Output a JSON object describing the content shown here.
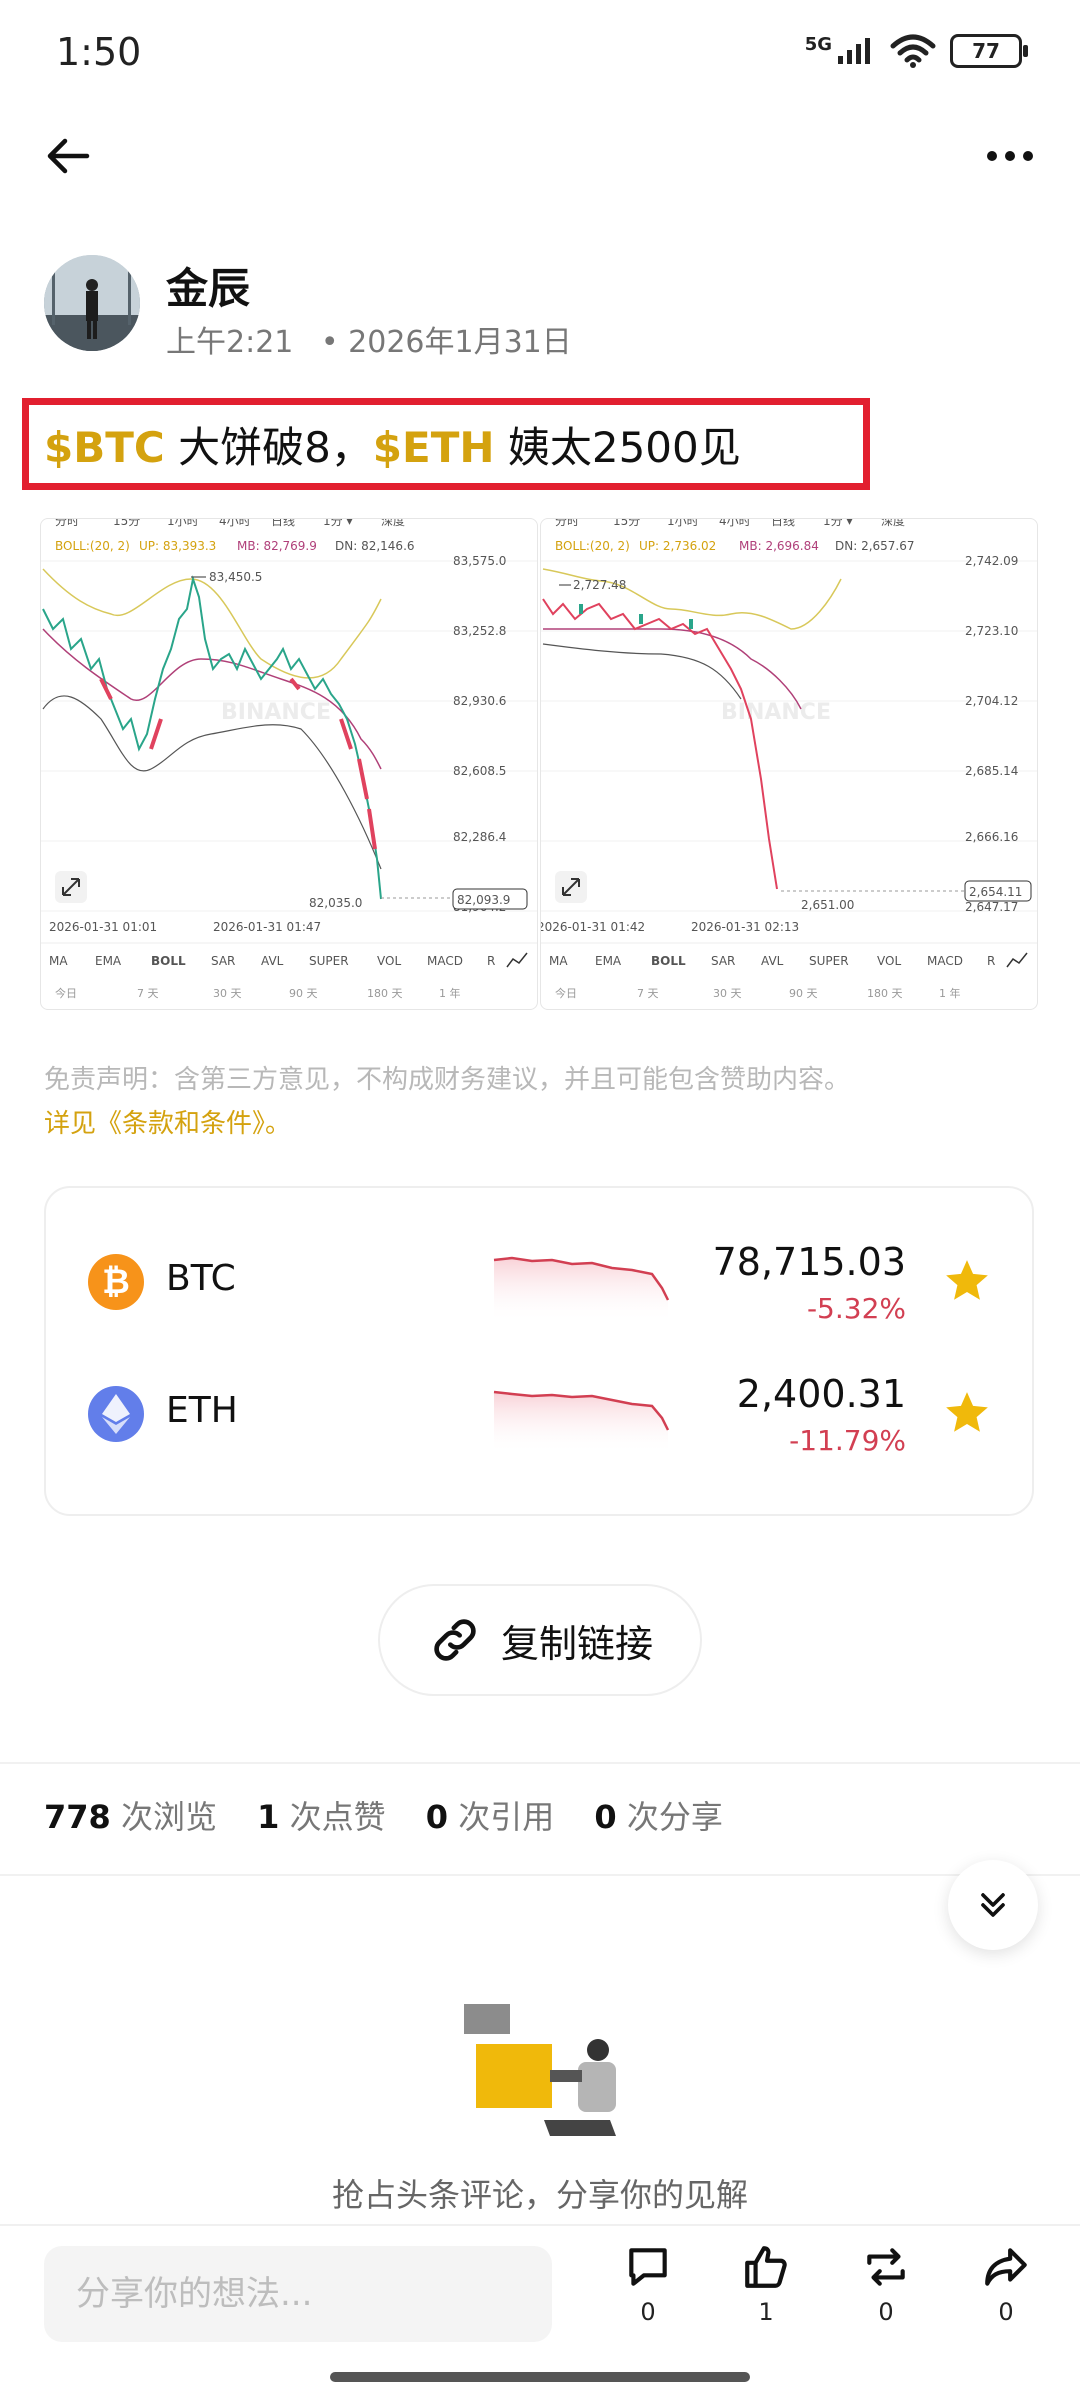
{
  "status": {
    "time": "1:50",
    "network": "5G",
    "battery": "77"
  },
  "post": {
    "author": "金辰",
    "time": "上午2:21",
    "date": "• 2026年1月31日",
    "headline_tag1": "$BTC",
    "headline_mid": " 大饼破8，",
    "headline_tag2": "$ETH",
    "headline_end": " 姨太2500见"
  },
  "charts": [
    {
      "pair": "BTC",
      "tabs": [
        "分时",
        "15分",
        "1小时",
        "4小时",
        "日线",
        "1分 ▾",
        "深度"
      ],
      "boll_label": "BOLL:(20, 2)",
      "up": "UP: 83,393.3",
      "mb": "MB: 82,769.9",
      "dn": "DN: 82,146.6",
      "y_ticks": [
        "83,575.0",
        "83,252.8",
        "82,930.6",
        "82,608.5",
        "82,286.4",
        "81,964.2"
      ],
      "high_label": "83,450.5",
      "low_label": "82,035.0",
      "current": "82,093.9",
      "x_ticks": [
        "2026-01-31 01:01",
        "2026-01-31 01:47"
      ],
      "indicators": [
        "MA",
        "EMA",
        "BOLL",
        "SAR",
        "AVL",
        "SUPER",
        "VOL",
        "MACD",
        "R"
      ],
      "periods": [
        "今日",
        "7 天",
        "30 天",
        "90 天",
        "180 天",
        "1 年"
      ],
      "watermark": "BINANCE"
    },
    {
      "pair": "ETH",
      "tabs": [
        "分时",
        "15分",
        "1小时",
        "4小时",
        "日线",
        "1分 ▾",
        "深度"
      ],
      "boll_label": "BOLL:(20, 2)",
      "up": "UP: 2,736.02",
      "mb": "MB: 2,696.84",
      "dn": "DN: 2,657.67",
      "y_ticks": [
        "2,742.09",
        "2,723.10",
        "2,704.12",
        "2,685.14",
        "2,666.16",
        "2,647.17"
      ],
      "high_label": "2,727.48",
      "low_label": "2,651.00",
      "current": "2,654.11",
      "x_ticks": [
        "2026-01-31 01:42",
        "2026-01-31 02:13"
      ],
      "indicators": [
        "MA",
        "EMA",
        "BOLL",
        "SAR",
        "AVL",
        "SUPER",
        "VOL",
        "MACD",
        "R"
      ],
      "periods": [
        "今日",
        "7 天",
        "30 天",
        "90 天",
        "180 天",
        "1 年"
      ],
      "watermark": "BINANCE"
    }
  ],
  "disclaimer": {
    "text": "免责声明：含第三方意见，不构成财务建议，并且可能包含赞助内容。",
    "link": " 详见《条款和条件》。"
  },
  "coins": [
    {
      "symbol": "BTC",
      "price": "78,715.03",
      "change": "-5.32%",
      "icon": "bitcoin-icon",
      "color": "#f7931a"
    },
    {
      "symbol": "ETH",
      "price": "2,400.31",
      "change": "-11.79%",
      "icon": "ethereum-icon",
      "color": "#627eea"
    }
  ],
  "copy_link": "复制链接",
  "stats": [
    {
      "count": "778",
      "label": "次浏览"
    },
    {
      "count": "1",
      "label": "次点赞"
    },
    {
      "count": "0",
      "label": "次引用"
    },
    {
      "count": "0",
      "label": "次分享"
    }
  ],
  "empty_comments": "抢占头条评论，分享你的见解",
  "bottom": {
    "placeholder": "分享你的想法...",
    "comment_count": "0",
    "like_count": "1",
    "repost_count": "0",
    "share_count": "0"
  },
  "colors": {
    "accent": "#d4a20f",
    "down": "#d23f52",
    "highlight": "#e21f2f"
  }
}
